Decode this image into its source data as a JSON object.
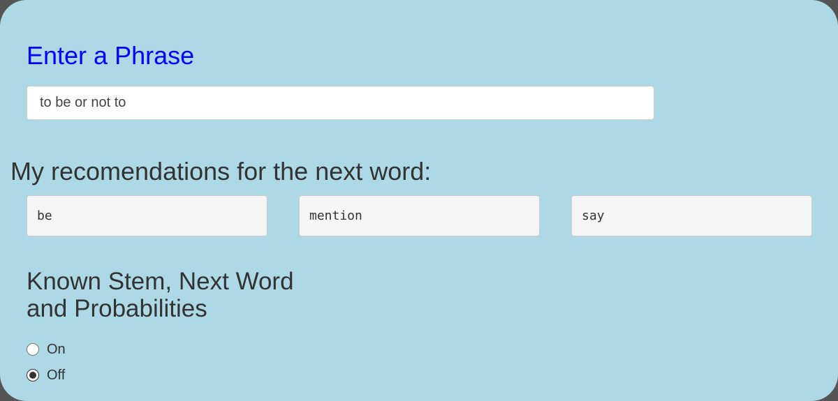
{
  "phrase_section": {
    "title": "Enter a Phrase",
    "input_value": "to be or not to"
  },
  "recommendations": {
    "title": "My recomendations for the next word:",
    "words": [
      "be",
      "mention",
      "say"
    ]
  },
  "known_stem": {
    "title_line1": "Known Stem, Next Word",
    "title_line2": "and Probabilities",
    "options": [
      {
        "label": "On",
        "selected": false
      },
      {
        "label": "Off",
        "selected": true
      }
    ]
  },
  "colors": {
    "panel_background": "#add8e6",
    "phrase_title": "#0000ff",
    "text": "#333333"
  }
}
